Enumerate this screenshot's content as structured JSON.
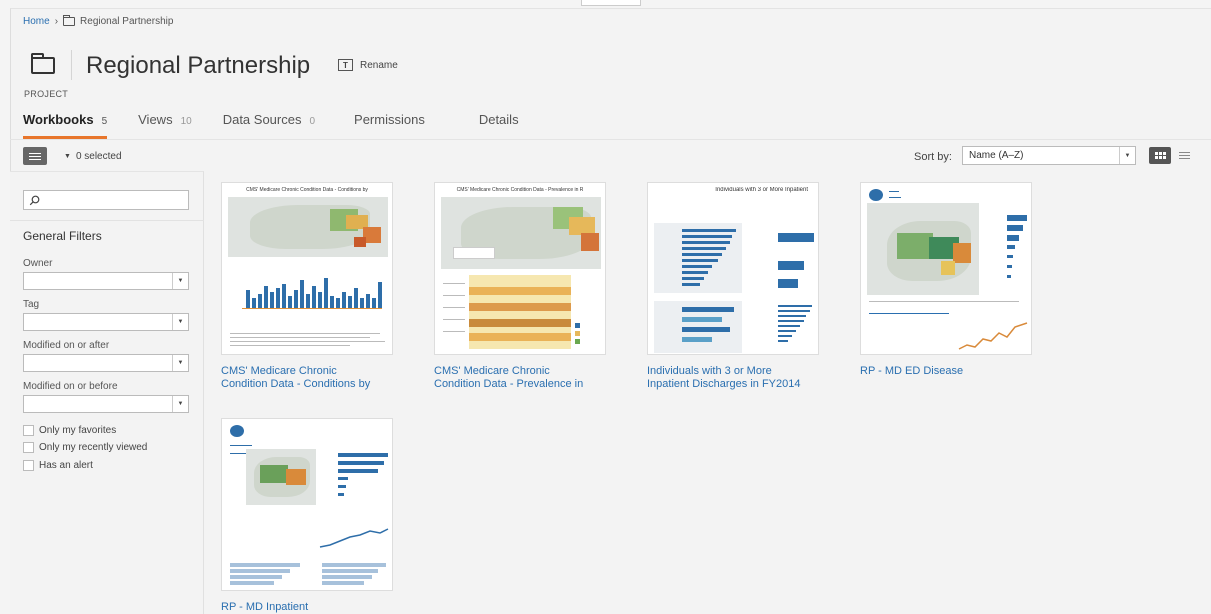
{
  "breadcrumb": {
    "home": "Home",
    "separator": "›",
    "project": "Regional Partnership"
  },
  "project": {
    "label": "PROJECT",
    "title": "Regional Partnership",
    "rename_label": "Rename"
  },
  "tabs": [
    {
      "label": "Workbooks",
      "count": "5"
    },
    {
      "label": "Views",
      "count": "10"
    },
    {
      "label": "Data Sources",
      "count": "0"
    },
    {
      "label": "Permissions",
      "count": ""
    },
    {
      "label": "Details",
      "count": ""
    }
  ],
  "toolbar": {
    "selected_text": "0 selected",
    "sort_label": "Sort by:",
    "sort_value": "Name (A–Z)"
  },
  "sidebar": {
    "search_placeholder": "",
    "general_filters": "General Filters",
    "filters": [
      {
        "label": "Owner",
        "value": ""
      },
      {
        "label": "Tag",
        "value": ""
      },
      {
        "label": "Modified on or after",
        "value": ""
      },
      {
        "label": "Modified on or before",
        "value": ""
      }
    ],
    "checkboxes": [
      {
        "label": "Only my favorites"
      },
      {
        "label": "Only my recently viewed"
      },
      {
        "label": "Has an alert"
      }
    ]
  },
  "workbooks": [
    {
      "title_line1": "CMS' Medicare Chronic",
      "title_line2": "Condition Data - Conditions by",
      "thumb_heading": "CMS' Medicare Chronic Condition Data - Conditions by"
    },
    {
      "title_line1": "CMS' Medicare Chronic",
      "title_line2": "Condition Data - Prevalence in",
      "thumb_heading": "CMS' Medicare Chronic Condition Data - Prevalence in R"
    },
    {
      "title_line1": "Individuals with 3 or More",
      "title_line2": "Inpatient Discharges in FY2014",
      "thumb_heading": "Individuals with 3 or More Inpatient"
    },
    {
      "title_line1": "RP - MD ED Disease",
      "title_line2": "",
      "thumb_heading": ""
    },
    {
      "title_line1": "RP - MD Inpatient",
      "title_line2": "",
      "thumb_heading": ""
    }
  ],
  "colors": {
    "accent": "#e8762b",
    "link": "#2a6fb0",
    "bar": "#2e6ea9"
  },
  "icons": [
    "folder-icon",
    "rename-icon",
    "filter-icon",
    "search-icon",
    "grid-view-icon",
    "list-view-icon",
    "chevron-down-icon"
  ]
}
